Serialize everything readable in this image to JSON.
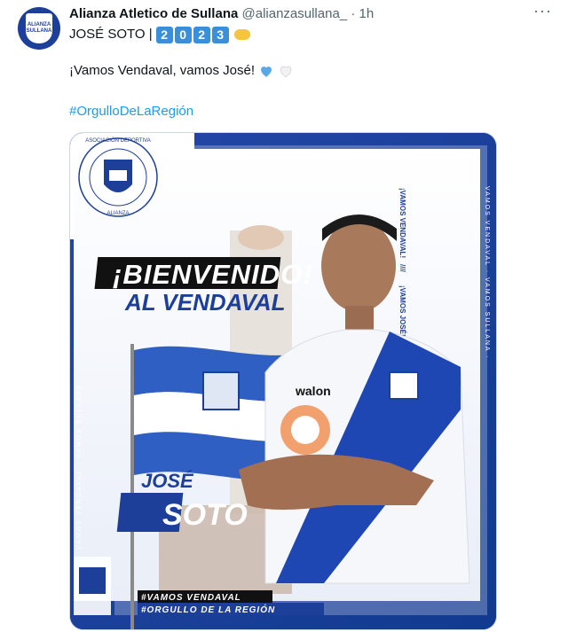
{
  "tweet": {
    "author_name": "Alianza Atletico de Sullana",
    "handle": "@alianzasullana_",
    "separator": "·",
    "time": "1h",
    "more_icon": "more-icon",
    "line1_prefix": "JOSÉ SOTO |",
    "year_digits": [
      "2",
      "0",
      "2",
      "3"
    ],
    "line2_text": "¡Vamos Vendaval, vamos José!",
    "hashtag": "#OrgulloDeLaRegión"
  },
  "poster": {
    "badge_ring_text": "ASOCIACIÓN DEPORTIVA",
    "badge_ring_bottom": "ALIANZA",
    "badge_name_top": "ALIANZA",
    "badge_name_bottom": "SULLANA",
    "welcome": "¡BIENVENIDO!",
    "welcome_sub": "AL VENDAVAL",
    "vertical_1": "¡VAMOS VENDAVAL!",
    "vertical_sep": "////",
    "vertical_2": "¡VAMOS JOSÉ!",
    "side_text": "VAMOS VENDAVAL · VAMOS SULLANA ·",
    "player_first": "JOSÉ",
    "player_last": "SOTO",
    "sponsor": "walon",
    "footer_1": "#VAMOS VENDAVAL",
    "footer_2": "#ORGULLO DE LA REGIÓN",
    "colors": {
      "brand_blue": "#1d3f9a",
      "accent_blue": "#3b8fd8",
      "link": "#1d9bf0"
    }
  }
}
